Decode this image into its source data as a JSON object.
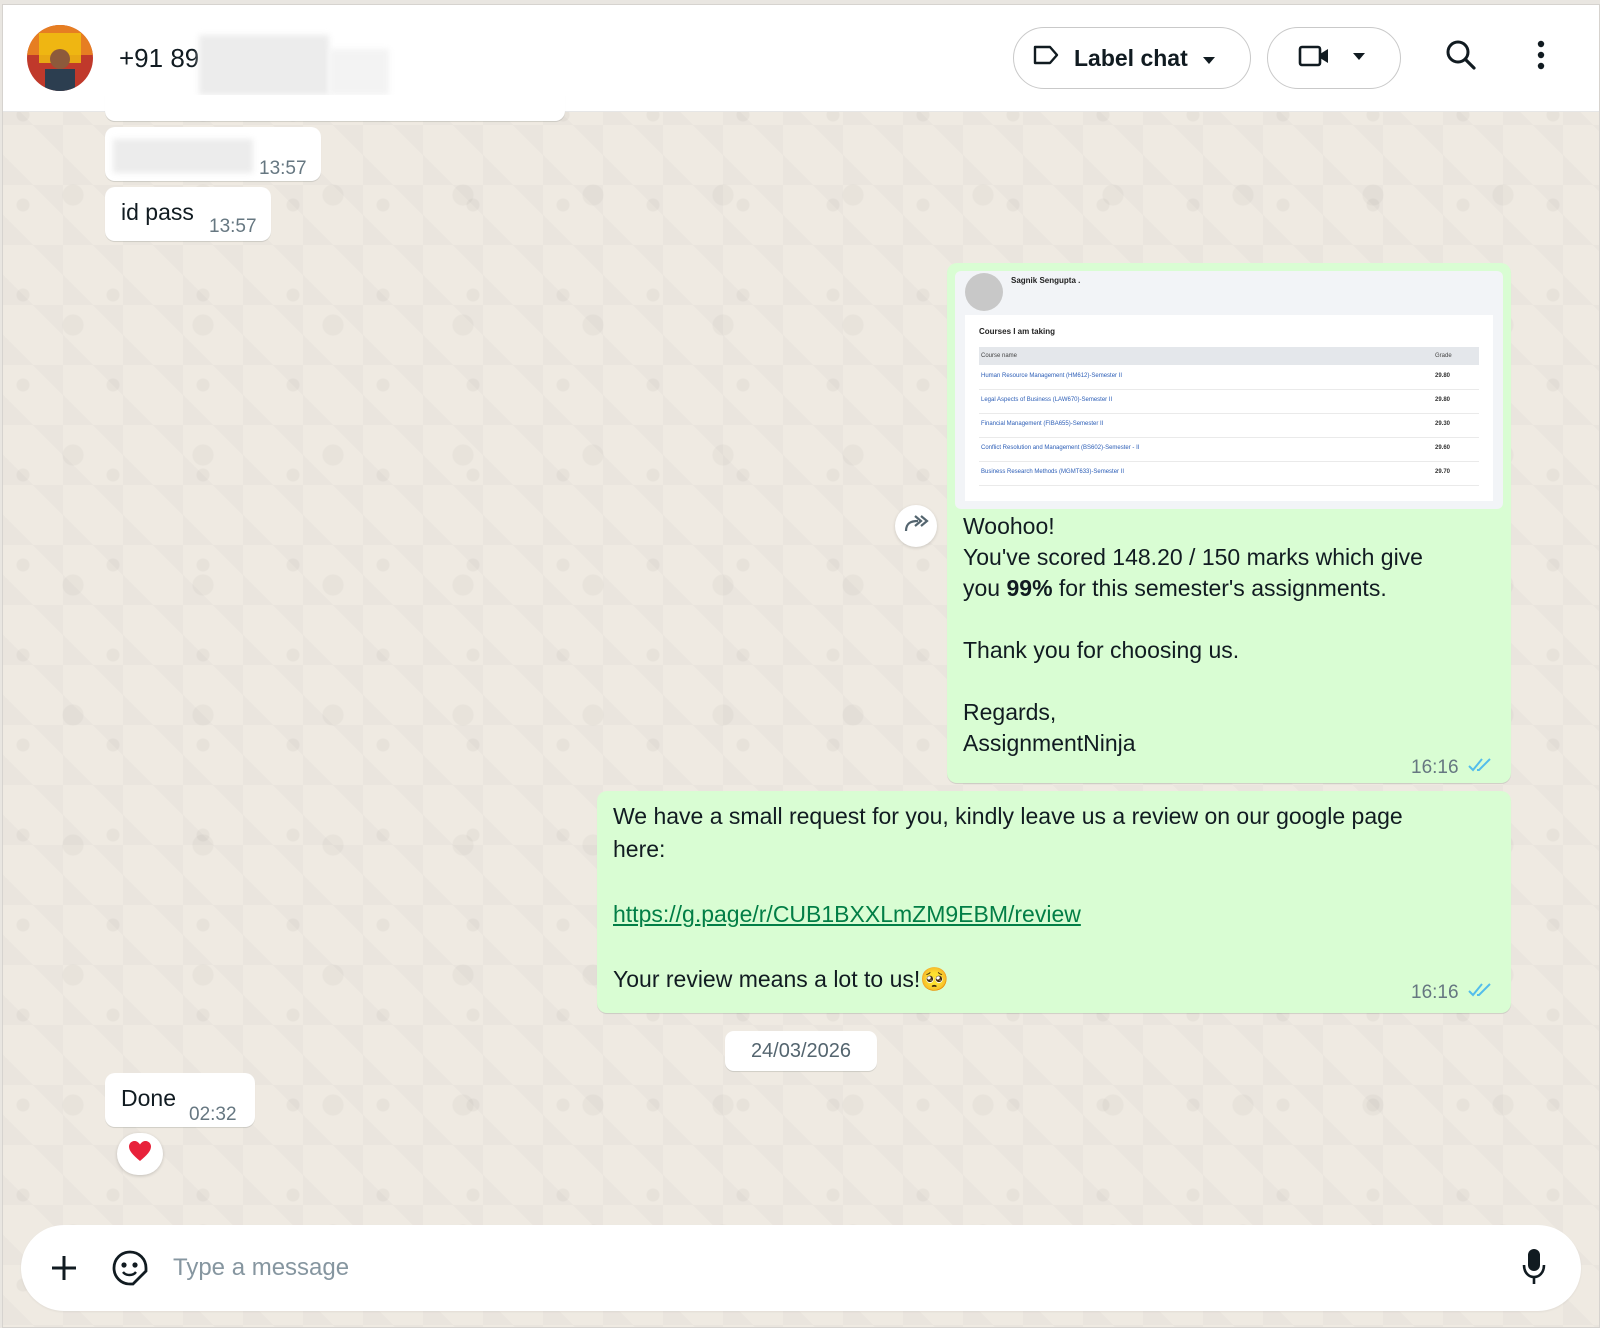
{
  "header": {
    "contact_name": "+91 89",
    "label_chat": "Label chat",
    "icons": [
      "avatar",
      "label-icon",
      "chevron-down-icon",
      "video-icon",
      "chevron-down-icon",
      "search-icon",
      "kebab-menu-icon"
    ]
  },
  "messages": {
    "m1": {
      "time": "13:57"
    },
    "m2": {
      "text": "id pass",
      "time": "13:57"
    },
    "m3": {
      "preview": {
        "name": "Sagnik Sengupta .",
        "heading": "Courses I am taking",
        "col_course": "Course name",
        "col_grade": "Grade",
        "rows": [
          {
            "course": "Human Resource Management (HM612)-Semester II",
            "grade": "29.80"
          },
          {
            "course": "Legal Aspects of Business (LAW670)-Semester II",
            "grade": "29.80"
          },
          {
            "course": "Financial Management (FIBA655)-Semester II",
            "grade": "29.30"
          },
          {
            "course": "Conflict Resolution and Management (BS602)-Semester - II",
            "grade": "29.60"
          },
          {
            "course": "Business Research Methods (MGMT633)-Semester II",
            "grade": "29.70"
          }
        ]
      },
      "line1": "Woohoo!",
      "line2": "You've scored 148.20 / 150 marks which give",
      "line3_pre": "you ",
      "line3_bold": "99%",
      "line3_post": " for this semester's assignments.",
      "line4": "Thank you for choosing us.",
      "line5": "Regards,",
      "line6": "AssignmentNinja",
      "time": "16:16"
    },
    "m4": {
      "line1": "We have a small request for you, kindly leave us a review on our google page",
      "line2": "here:",
      "link": "https://g.page/r/CUB1BXXLmZM9EBM/review",
      "line3": "Your review means a lot to us!",
      "emoji": "🥺",
      "time": "16:16"
    },
    "date_chip": "24/03/2026",
    "m5": {
      "text": "Done",
      "time": "02:32",
      "reaction": "❤"
    }
  },
  "composer": {
    "placeholder": "Type a message",
    "icons": [
      "plus-icon",
      "sticker-icon",
      "mic-icon"
    ]
  },
  "colors": {
    "incoming_bubble": "#ffffff",
    "outgoing_bubble": "#d9fdd3",
    "chat_background": "#efeae2",
    "read_ticks": "#53bdeb"
  }
}
